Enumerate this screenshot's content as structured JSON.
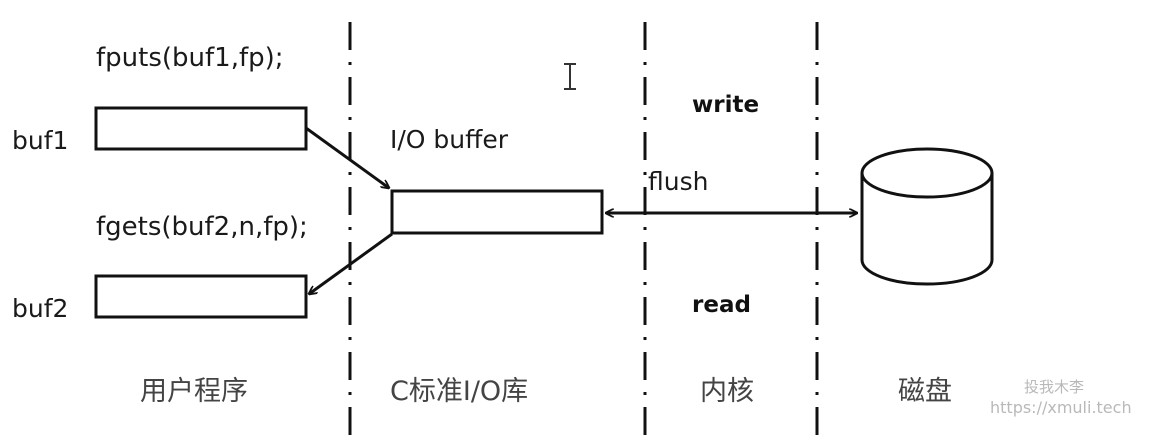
{
  "code": {
    "fputs": "fputs(buf1,fp);",
    "fgets": "fgets(buf2,n,fp);"
  },
  "labels": {
    "buf1": "buf1",
    "buf2": "buf2",
    "io_buffer": "I/O buffer",
    "flush": "flush",
    "write": "write",
    "read": "read"
  },
  "zones": [
    "用户程序",
    "C标准I/O库",
    "内核",
    "磁盘"
  ],
  "watermark": {
    "line1": "投我木李",
    "line2": "https://xmuli.tech"
  },
  "icons": {
    "cursor": "text-cursor-icon",
    "disk": "disk-cylinder-icon"
  },
  "colors": {
    "stroke": "#111111",
    "text": "#1a1a1a",
    "watermark": "#b9b9b9"
  }
}
